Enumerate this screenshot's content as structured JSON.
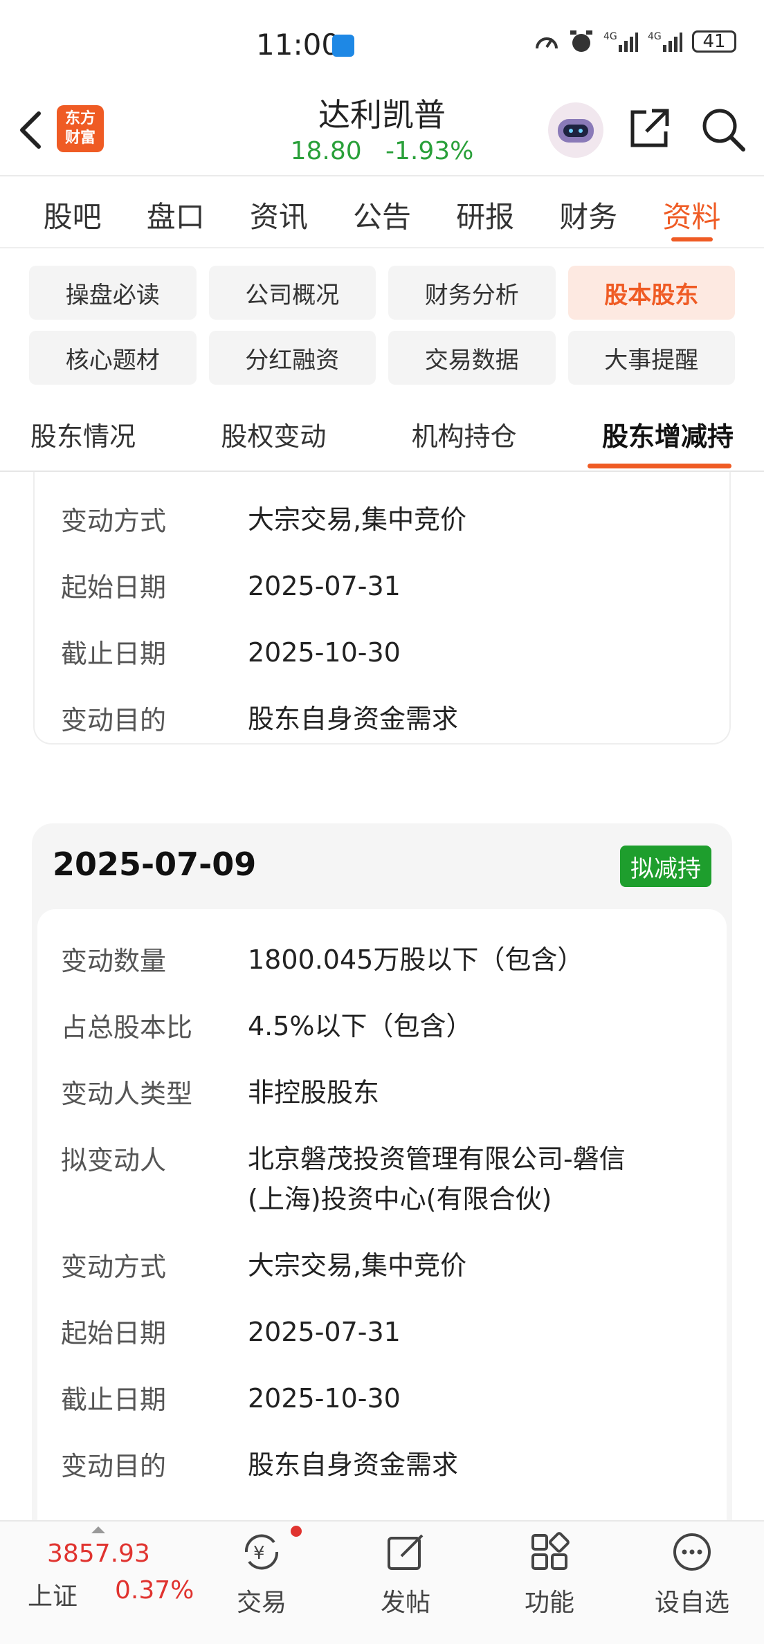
{
  "status_bar": {
    "time": "11:00",
    "battery": "41"
  },
  "header": {
    "logo": "东方财富",
    "stock_name": "达利凯普",
    "price": "18.80",
    "change": "-1.93%"
  },
  "tabs": [
    "股吧",
    "盘口",
    "资讯",
    "公告",
    "研报",
    "财务",
    "资料"
  ],
  "chips": [
    "操盘必读",
    "公司概况",
    "财务分析",
    "股本股东",
    "核心题材",
    "分红融资",
    "交易数据",
    "大事提醒"
  ],
  "subtabs": [
    "股东情况",
    "股权变动",
    "机构持仓",
    "股东增减持"
  ],
  "prev_card": {
    "rows": [
      {
        "k": "变动方式",
        "v": "大宗交易,集中竞价"
      },
      {
        "k": "起始日期",
        "v": "2025-07-31"
      },
      {
        "k": "截止日期",
        "v": "2025-10-30"
      },
      {
        "k": "变动目的",
        "v": "股东自身资金需求"
      }
    ]
  },
  "card": {
    "date": "2025-07-09",
    "badge": "拟减持",
    "rows": [
      {
        "k": "变动数量",
        "v": "1800.045万股以下（包含）"
      },
      {
        "k": "占总股本比",
        "v": "4.5%以下（包含）"
      },
      {
        "k": "变动人类型",
        "v": "非控股股东"
      },
      {
        "k": "拟变动人",
        "v": "北京磐茂投资管理有限公司-磐信",
        "v2": "(上海)投资中心(有限合伙)"
      },
      {
        "k": "变动方式",
        "v": "大宗交易,集中竞价"
      },
      {
        "k": "起始日期",
        "v": "2025-07-31"
      },
      {
        "k": "截止日期",
        "v": "2025-10-30"
      },
      {
        "k": "变动目的",
        "v": "股东自身资金需求"
      }
    ]
  },
  "bottom": {
    "index_value": "3857.93",
    "index_name": "上证",
    "index_pct": "0.37%",
    "nav": [
      "交易",
      "发帖",
      "功能",
      "设自选"
    ]
  },
  "colors": {
    "accent": "#ef5b24",
    "down": "#2aa03a",
    "up": "#e0332f",
    "badge": "#1e9e2d"
  }
}
